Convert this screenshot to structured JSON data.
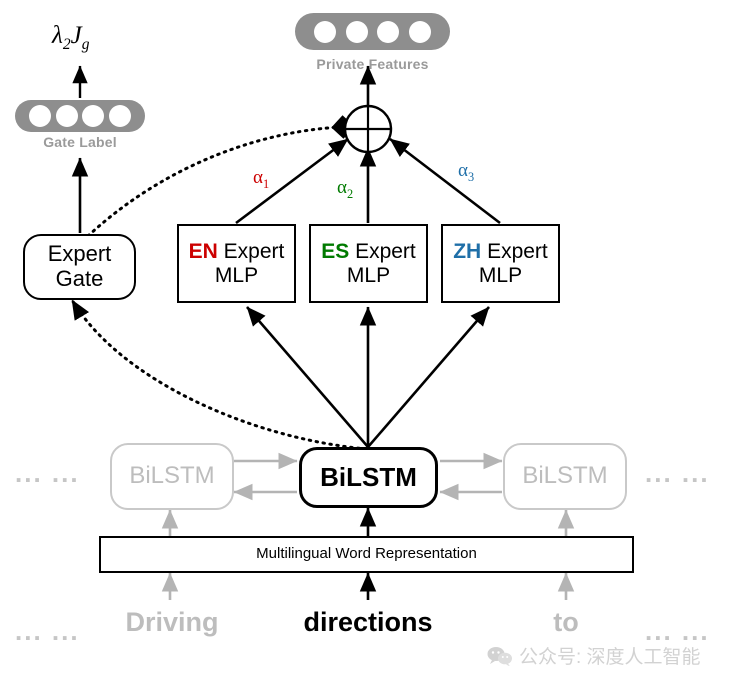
{
  "figure": {
    "title": "Multilingual expert-gated BiLSTM architecture",
    "colors": {
      "en": "#cc0000",
      "es": "#007a00",
      "zh": "#1f6fa8",
      "pill_gray": "#8e8e8e",
      "muted_gray": "#bdbdbd",
      "line_black": "#000000",
      "line_gray": "#b4b4b4"
    }
  },
  "outputs": {
    "loss_label": "λ₂Jg",
    "loss_lambda": "λ",
    "loss_lambda_sub": "2",
    "loss_j": "J",
    "loss_j_sub": "g",
    "gate_label_caption": "Gate Label",
    "private_features_caption": "Private Features",
    "gate_label_units": 4,
    "private_features_units": 4
  },
  "gate": {
    "label_line1": "Expert",
    "label_line2": "Gate"
  },
  "experts": [
    {
      "lang": "EN",
      "rest": " Expert",
      "line2": "MLP",
      "color": "#cc0000",
      "weight_label": "α1",
      "weight_sym": "α",
      "weight_sub": "1"
    },
    {
      "lang": "ES",
      "rest": " Expert",
      "line2": "MLP",
      "color": "#007a00",
      "weight_label": "α2",
      "weight_sym": "α",
      "weight_sub": "2"
    },
    {
      "lang": "ZH",
      "rest": " Expert",
      "line2": "MLP",
      "color": "#1f6fa8",
      "weight_label": "α3",
      "weight_sym": "α",
      "weight_sub": "3"
    }
  ],
  "combiner": {
    "operator": "⊕",
    "name": "sum-node"
  },
  "encoder": {
    "left_cell": "BiLSTM",
    "center_cell": "BiLSTM",
    "right_cell": "BiLSTM",
    "embedding_layer": "Multilingual Word Representation",
    "left_ellipsis": "...  ...",
    "right_ellipsis": "...  ..."
  },
  "tokens": {
    "left_ellipsis": "...  ...",
    "word_left": "Driving",
    "word_center": "directions",
    "word_right": "to",
    "right_ellipsis": "...  ..."
  },
  "watermark": {
    "text": "公众号: 深度人工智能"
  }
}
